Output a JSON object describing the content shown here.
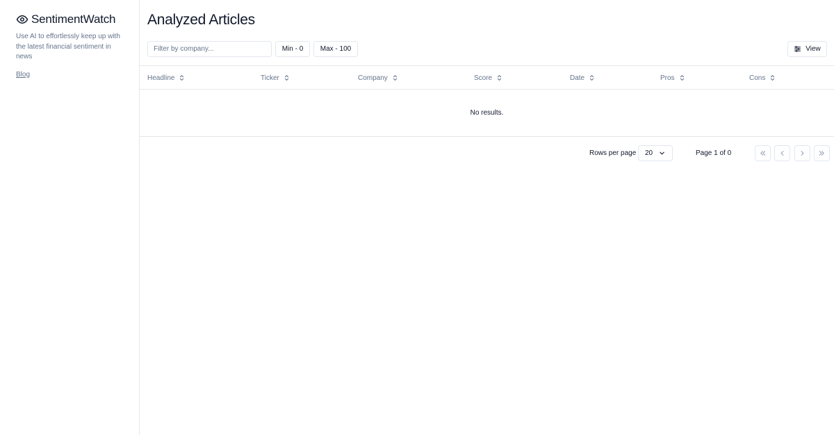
{
  "sidebar": {
    "brand_name": "SentimentWatch",
    "tagline": "Use AI to effortlessly keep up with the latest financial sentiment in news",
    "blog_link": "Blog"
  },
  "main": {
    "title": "Analyzed Articles",
    "filter": {
      "placeholder": "Filter by company..."
    },
    "min_filter": "Min - 0",
    "max_filter": "Max - 100",
    "view_button": "View",
    "columns": [
      "Headline",
      "Ticker",
      "Company",
      "Score",
      "Date",
      "Pros",
      "Cons"
    ],
    "empty_message": "No results.",
    "pagination": {
      "rows_per_page_label": "Rows per page",
      "rows_per_page_value": "20",
      "page_info": "Page 1 of 0"
    }
  },
  "icons": {
    "brand": "eye-icon",
    "view": "sliders-icon",
    "sort": "chevron-up-down-icon",
    "select": "chevron-down-icon",
    "first": "double-chevron-left-icon",
    "prev": "chevron-left-icon",
    "next": "chevron-right-icon",
    "last": "double-chevron-right-icon"
  }
}
